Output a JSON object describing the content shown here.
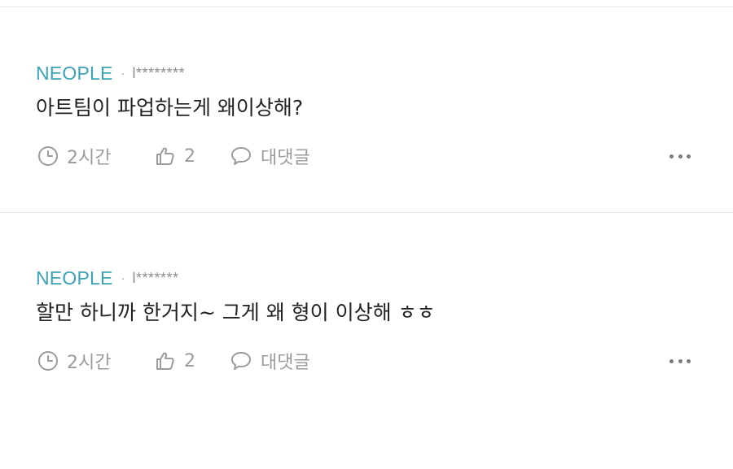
{
  "comments": [
    {
      "source": "NEOPLE",
      "separator": "·",
      "author": "l********",
      "text": "아트팀이 파업하는게 왜이상해?",
      "time": "2시간",
      "likes": "2",
      "reply_label": "대댓글"
    },
    {
      "source": "NEOPLE",
      "separator": "·",
      "author": "l*******",
      "text": "할만 하니까 한거지~ 그게 왜 형이 이상해 ㅎㅎ",
      "time": "2시간",
      "likes": "2",
      "reply_label": "대댓글"
    }
  ],
  "icons": {
    "time": "clock-icon",
    "like": "thumbs-up-icon",
    "reply": "speech-bubble-icon",
    "more": "more-icon"
  },
  "colors": {
    "source": "#3aa3b6",
    "muted": "#9b9b9b",
    "text": "#222222",
    "divider": "#e8e8e8"
  }
}
